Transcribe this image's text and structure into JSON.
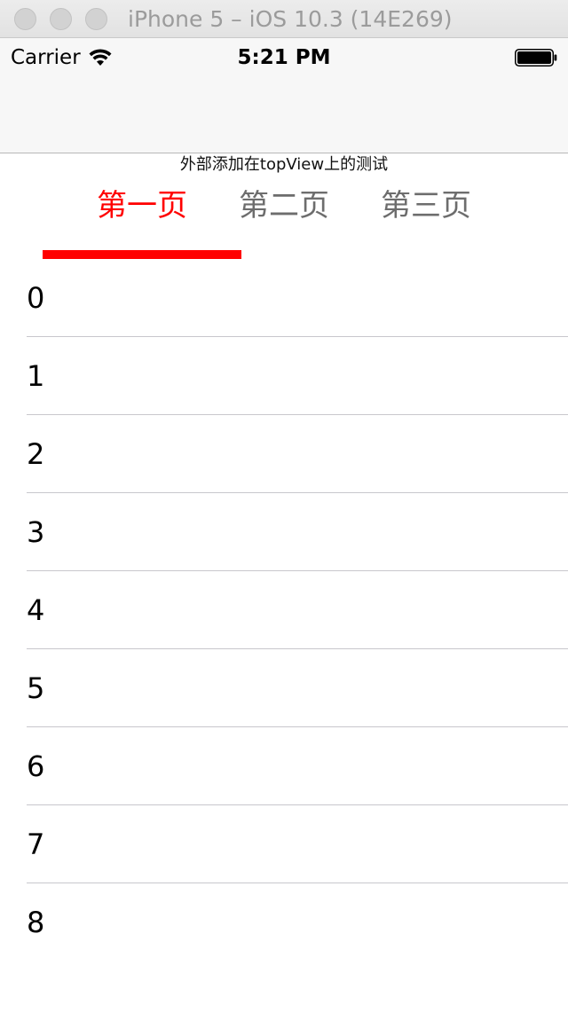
{
  "window": {
    "title": "iPhone 5 – iOS 10.3 (14E269)"
  },
  "status_bar": {
    "carrier": "Carrier",
    "time": "5:21 PM",
    "wifi_icon": "wifi-icon",
    "battery_icon": "battery-icon"
  },
  "top_view": {
    "caption": "外部添加在topView上的测试",
    "tabs": [
      {
        "label": "第一页",
        "active": true
      },
      {
        "label": "第二页",
        "active": false
      },
      {
        "label": "第三页",
        "active": false
      }
    ],
    "active_color": "#ff0000",
    "inactive_color": "#6d6d6d"
  },
  "table": {
    "rows": [
      "0",
      "1",
      "2",
      "3",
      "4",
      "5",
      "6",
      "7",
      "8"
    ]
  }
}
